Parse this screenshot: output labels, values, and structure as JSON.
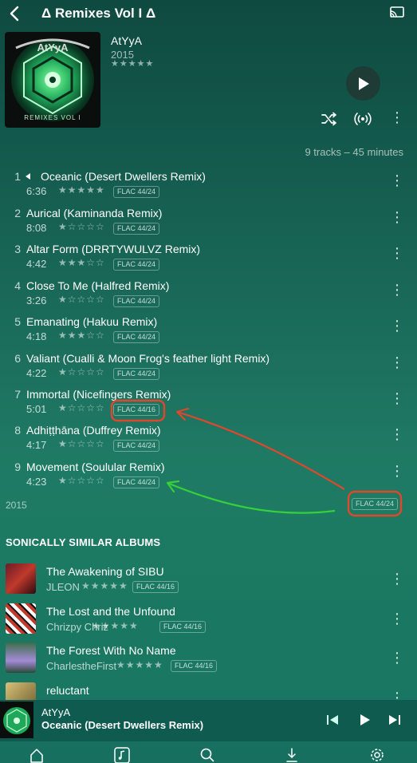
{
  "header": {
    "title": "Δ Remixes Vol I Δ"
  },
  "album": {
    "artist": "AtYyA",
    "year": "2015",
    "stars": "★★★★★",
    "cover_text": "REMIXES VOL I",
    "summary": "9 tracks – 45 minutes"
  },
  "tracks": [
    {
      "num": "1",
      "title": "Oceanic (Desert Dwellers Remix)",
      "duration": "6:36",
      "stars": "★★★★★",
      "format": "FLAC 44/24",
      "playing": true
    },
    {
      "num": "2",
      "title": "Aurical (Kaminanda Remix)",
      "duration": "8:08",
      "stars": "★☆☆☆☆",
      "format": "FLAC 44/24"
    },
    {
      "num": "3",
      "title": "Altar Form (DRRTYWULVZ Remix)",
      "duration": "4:42",
      "stars": "★★★☆☆",
      "format": "FLAC 44/24"
    },
    {
      "num": "4",
      "title": "Close To Me (Halfred Remix)",
      "duration": "3:26",
      "stars": "★☆☆☆☆",
      "format": "FLAC 44/24"
    },
    {
      "num": "5",
      "title": "Emanating (Hakuu Remix)",
      "duration": "4:18",
      "stars": "★★★☆☆",
      "format": "FLAC 44/24"
    },
    {
      "num": "6",
      "title": "Valiant (Cualli & Moon Frog's feather light Remix)",
      "duration": "4:22",
      "stars": "★☆☆☆☆",
      "format": "FLAC 44/24"
    },
    {
      "num": "7",
      "title": "Immortal (Nicefingers Remix)",
      "duration": "5:01",
      "stars": "★☆☆☆☆",
      "format": "FLAC 44/16"
    },
    {
      "num": "8",
      "title": "Adhiṭṭhāna (Duffrey Remix)",
      "duration": "4:17",
      "stars": "★☆☆☆☆",
      "format": "FLAC 44/24"
    },
    {
      "num": "9",
      "title": "Movement (Soulular Remix)",
      "duration": "4:23",
      "stars": "★☆☆☆☆",
      "format": "FLAC 44/24"
    }
  ],
  "footer_year": "2015",
  "annotation_flac": "FLAC 44/24",
  "similar": {
    "heading": "SONICALLY SIMILAR ALBUMS",
    "items": [
      {
        "title": "The Awakening of SIBU",
        "artist": "JLEON",
        "stars": "★★★★★",
        "format": "FLAC 44/16"
      },
      {
        "title": "The Lost and the Unfound",
        "artist": "Chrizpy Chriz",
        "stars": "★★★★★",
        "format": "FLAC 44/16"
      },
      {
        "title": "The Forest With No Name",
        "artist": "CharlestheFirst",
        "stars": "★★★★★",
        "format": "FLAC 44/16"
      },
      {
        "title": "reluctant",
        "artist": "",
        "stars": "",
        "format": ""
      }
    ]
  },
  "mini_player": {
    "artist": "AtYyA",
    "title": "Oceanic (Desert Dwellers Remix)"
  },
  "colors": {
    "accent": "#1f7a64",
    "annotation_red": "#e0472c",
    "annotation_green": "#35d03a"
  }
}
